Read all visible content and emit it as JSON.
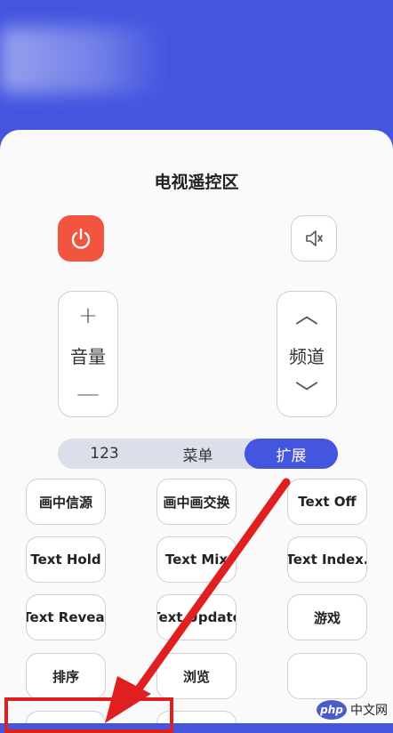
{
  "panel": {
    "title": "电视遥控区"
  },
  "volume": {
    "label": "音量",
    "plus": "+",
    "minus": "—"
  },
  "channel": {
    "label": "频道",
    "up": "︿",
    "down": "﹀"
  },
  "tabs": [
    {
      "label": "123",
      "active": false
    },
    {
      "label": "菜单",
      "active": false
    },
    {
      "label": "扩展",
      "active": true
    }
  ],
  "buttons": [
    {
      "label": "画中信源"
    },
    {
      "label": "画中画交换"
    },
    {
      "label": "Text Off"
    },
    {
      "label": "Text Hold"
    },
    {
      "label": "Text Mix"
    },
    {
      "label": "Text Index."
    },
    {
      "label": "Text Reveal"
    },
    {
      "label": "Text Update"
    },
    {
      "label": "游戏"
    },
    {
      "label": "排序"
    },
    {
      "label": "浏览"
    },
    {
      "label": ""
    }
  ],
  "watermark": {
    "logo": "php",
    "text": "中文网"
  },
  "colors": {
    "primary": "#4455e0",
    "power": "#f2553f",
    "annotation": "#e02020"
  },
  "icons": {
    "power": "power-icon",
    "mute": "mute-icon"
  }
}
